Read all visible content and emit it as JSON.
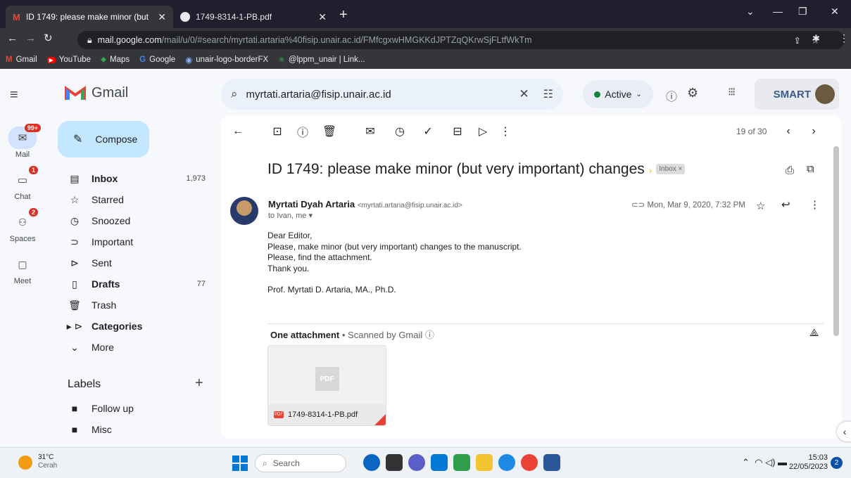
{
  "browser": {
    "tabs": [
      {
        "title": "ID 1749: please make minor (but",
        "active": true
      },
      {
        "title": "1749-8314-1-PB.pdf",
        "active": false
      }
    ],
    "url_domain": "mail.google.com",
    "url_path": "/mail/u/0/#search/myrtati.artaria%40fisip.unair.ac.id/FMfcgxwHMGKKdJPTZqQKrwSjFLtfWkTm",
    "bookmarks": [
      "Gmail",
      "YouTube",
      "Maps",
      "Google",
      "unair-logo-borderFX",
      "@lppm_unair | Link..."
    ]
  },
  "gmail": {
    "brand": "Gmail",
    "search_value": "myrtati.artaria@fisip.unair.ac.id",
    "status": "Active",
    "org_logo_text": "SMART",
    "rail": [
      {
        "label": "Mail",
        "badge": "99+"
      },
      {
        "label": "Chat",
        "badge": "1"
      },
      {
        "label": "Spaces",
        "badge": "2"
      },
      {
        "label": "Meet",
        "badge": ""
      }
    ],
    "compose_label": "Compose",
    "nav": [
      {
        "label": "Inbox",
        "count": "1,973",
        "bold": true
      },
      {
        "label": "Starred",
        "count": ""
      },
      {
        "label": "Snoozed",
        "count": ""
      },
      {
        "label": "Important",
        "count": ""
      },
      {
        "label": "Sent",
        "count": ""
      },
      {
        "label": "Drafts",
        "count": "77",
        "bold": true
      },
      {
        "label": "Trash",
        "count": ""
      },
      {
        "label": "Categories",
        "count": "",
        "bold": true
      },
      {
        "label": "More",
        "count": ""
      }
    ],
    "labels_heading": "Labels",
    "labels": [
      "Follow up",
      "Misc"
    ],
    "pager": "19 of 30",
    "message": {
      "subject": "ID 1749: please make minor (but very important) changes",
      "label_chip": "Inbox ×",
      "sender_name": "Myrtati Dyah Artaria",
      "sender_email": "<myrtati.artaria@fisip.unair.ac.id>",
      "recipients": "to Ivan, me ▾",
      "date": "Mon, Mar 9, 2020, 7:32 PM",
      "body": [
        "Dear Editor,",
        "Please, make minor (but very important) changes to the manuscript.",
        "Please, find the attachment.",
        "Thank you.",
        "",
        "Prof. Myrtati D. Artaria, MA., Ph.D."
      ],
      "attachments_heading": "One attachment",
      "scanned": "• Scanned by Gmail",
      "attachment_file": "1749-8314-1-PB.pdf",
      "attachment_preview": "PDF"
    }
  },
  "taskbar": {
    "temperature": "31°C",
    "weather": "Cerah",
    "search_placeholder": "Search",
    "time": "15:03",
    "date": "22/05/2023",
    "notif_count": "2"
  }
}
